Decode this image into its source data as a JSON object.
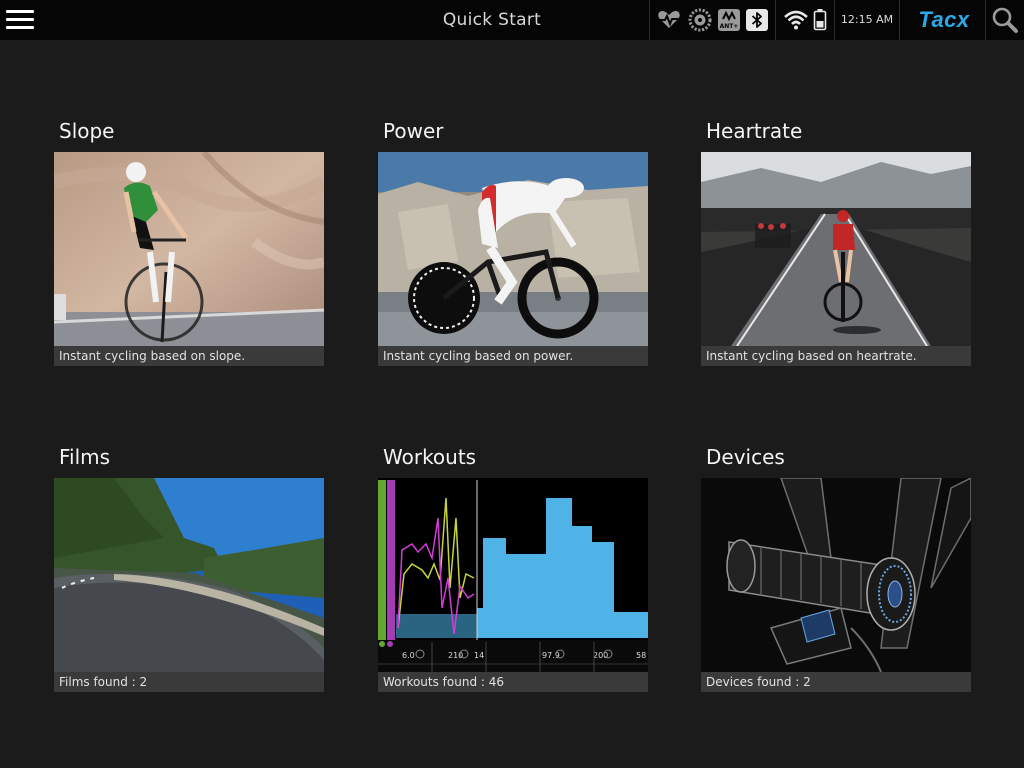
{
  "header": {
    "title": "Quick Start",
    "time": "12:15 AM",
    "brand": "Tacx",
    "brand_color": "#2aa9e8",
    "icons": [
      "menu-icon",
      "heart-sensor-icon",
      "cadence-sensor-icon",
      "ant-plus-icon",
      "bluetooth-icon",
      "wifi-icon",
      "battery-icon",
      "search-icon"
    ],
    "ant_label": "ANT+"
  },
  "tiles": [
    {
      "title": "Slope",
      "caption": "Instant cycling based on slope."
    },
    {
      "title": "Power",
      "caption": "Instant cycling based on power."
    },
    {
      "title": "Heartrate",
      "caption": "Instant cycling based on heartrate."
    },
    {
      "title": "Films",
      "caption": "Films found : 2"
    },
    {
      "title": "Workouts",
      "caption": "Workouts found : 46"
    },
    {
      "title": "Devices",
      "caption": "Devices found : 2"
    }
  ],
  "workout_chart": {
    "readouts": [
      "6.0",
      "210",
      "14",
      "97.9",
      "200",
      "58"
    ]
  }
}
